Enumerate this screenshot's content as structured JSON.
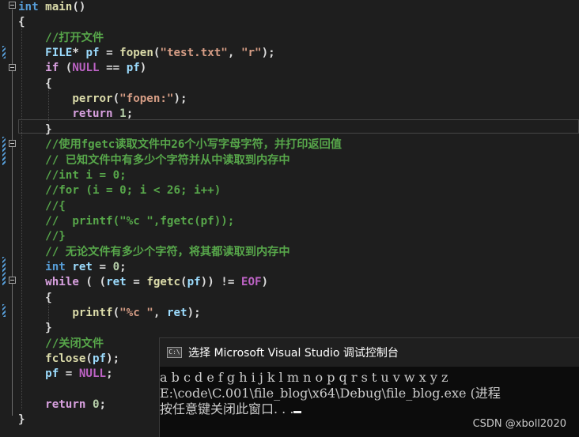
{
  "editor": {
    "lines": [
      {
        "n": "signature",
        "parts": [
          [
            "kw",
            "int"
          ],
          [
            "plain",
            " "
          ],
          [
            "fn",
            "main"
          ],
          [
            "plain",
            "()"
          ]
        ]
      },
      {
        "n": "open-brace",
        "parts": [
          [
            "plain",
            "{"
          ]
        ]
      },
      {
        "n": "comment-open-file",
        "parts": [
          [
            "plain",
            "    "
          ],
          [
            "cmt",
            "//打开文件"
          ]
        ]
      },
      {
        "n": "fopen-line",
        "parts": [
          [
            "plain",
            "    "
          ],
          [
            "var",
            "FILE"
          ],
          [
            "plain",
            "* "
          ],
          [
            "var",
            "pf"
          ],
          [
            "plain",
            " = "
          ],
          [
            "fn",
            "fopen"
          ],
          [
            "plain",
            "("
          ],
          [
            "str",
            "\"test.txt\""
          ],
          [
            "plain",
            ", "
          ],
          [
            "str",
            "\"r\""
          ],
          [
            "plain",
            ");"
          ]
        ]
      },
      {
        "n": "if-line",
        "parts": [
          [
            "plain",
            "    "
          ],
          [
            "ctrl",
            "if"
          ],
          [
            "plain",
            " ("
          ],
          [
            "mac",
            "NULL"
          ],
          [
            "plain",
            " == "
          ],
          [
            "var",
            "pf"
          ],
          [
            "plain",
            ")"
          ]
        ]
      },
      {
        "n": "if-open-brace",
        "parts": [
          [
            "plain",
            "    {"
          ]
        ]
      },
      {
        "n": "perror-line",
        "parts": [
          [
            "plain",
            "        "
          ],
          [
            "fn",
            "perror"
          ],
          [
            "plain",
            "("
          ],
          [
            "str",
            "\"fopen:\""
          ],
          [
            "plain",
            ");"
          ]
        ]
      },
      {
        "n": "return-1-line",
        "parts": [
          [
            "plain",
            "        "
          ],
          [
            "ctrl",
            "return"
          ],
          [
            "plain",
            " "
          ],
          [
            "num",
            "1"
          ],
          [
            "plain",
            ";"
          ]
        ]
      },
      {
        "n": "if-close-brace",
        "parts": [
          [
            "plain",
            "    }"
          ]
        ]
      },
      {
        "n": "comment-fgetc",
        "parts": [
          [
            "plain",
            "    "
          ],
          [
            "cmt",
            "//使用fgetc读取文件中26个小写字母字符，并打印返回值"
          ]
        ]
      },
      {
        "n": "comment-unknown",
        "parts": [
          [
            "plain",
            "    "
          ],
          [
            "cmt",
            "// 已知文件中有多少个字符并从中读取到内存中"
          ]
        ]
      },
      {
        "n": "comment-int-i",
        "parts": [
          [
            "plain",
            "    "
          ],
          [
            "cmt",
            "//int i = 0;"
          ]
        ]
      },
      {
        "n": "comment-for",
        "parts": [
          [
            "plain",
            "    "
          ],
          [
            "cmt",
            "//for (i = 0; i < 26; i++)"
          ]
        ]
      },
      {
        "n": "comment-brace-open",
        "parts": [
          [
            "plain",
            "    "
          ],
          [
            "cmt",
            "//{"
          ]
        ]
      },
      {
        "n": "comment-printf",
        "parts": [
          [
            "plain",
            "    "
          ],
          [
            "cmt",
            "//  printf(\"%c \",fgetc(pf));"
          ]
        ]
      },
      {
        "n": "comment-brace-close",
        "parts": [
          [
            "plain",
            "    "
          ],
          [
            "cmt",
            "//}"
          ]
        ]
      },
      {
        "n": "comment-unknown-count",
        "parts": [
          [
            "plain",
            "    "
          ],
          [
            "cmt",
            "// 无论文件有多少个字符，将其都读取到内存中"
          ]
        ]
      },
      {
        "n": "int-ret-line",
        "parts": [
          [
            "plain",
            "    "
          ],
          [
            "kw",
            "int"
          ],
          [
            "plain",
            " "
          ],
          [
            "var",
            "ret"
          ],
          [
            "plain",
            " = "
          ],
          [
            "num",
            "0"
          ],
          [
            "plain",
            ";"
          ]
        ]
      },
      {
        "n": "while-line",
        "parts": [
          [
            "plain",
            "    "
          ],
          [
            "ctrl",
            "while"
          ],
          [
            "plain",
            " ( ("
          ],
          [
            "var",
            "ret"
          ],
          [
            "plain",
            " = "
          ],
          [
            "fn",
            "fgetc"
          ],
          [
            "plain",
            "("
          ],
          [
            "var",
            "pf"
          ],
          [
            "plain",
            ")) != "
          ],
          [
            "mac",
            "EOF"
          ],
          [
            "plain",
            ")"
          ]
        ]
      },
      {
        "n": "while-open-brace",
        "parts": [
          [
            "plain",
            "    {"
          ]
        ]
      },
      {
        "n": "printf-line",
        "parts": [
          [
            "plain",
            "        "
          ],
          [
            "fn",
            "printf"
          ],
          [
            "plain",
            "("
          ],
          [
            "str",
            "\"%c \""
          ],
          [
            "plain",
            ", "
          ],
          [
            "var",
            "ret"
          ],
          [
            "plain",
            ");"
          ]
        ]
      },
      {
        "n": "while-close-brace",
        "parts": [
          [
            "plain",
            "    }"
          ]
        ]
      },
      {
        "n": "comment-close-file",
        "parts": [
          [
            "plain",
            "    "
          ],
          [
            "cmt",
            "//关闭文件"
          ]
        ]
      },
      {
        "n": "fclose-line",
        "parts": [
          [
            "plain",
            "    "
          ],
          [
            "fn",
            "fclose"
          ],
          [
            "plain",
            "("
          ],
          [
            "var",
            "pf"
          ],
          [
            "plain",
            ");"
          ]
        ]
      },
      {
        "n": "pf-null-line",
        "parts": [
          [
            "plain",
            "    "
          ],
          [
            "var",
            "pf"
          ],
          [
            "plain",
            " = "
          ],
          [
            "mac",
            "NULL"
          ],
          [
            "plain",
            ";"
          ]
        ]
      },
      {
        "n": "blank-line",
        "parts": [
          [
            "plain",
            ""
          ]
        ]
      },
      {
        "n": "return-0-line",
        "parts": [
          [
            "plain",
            "    "
          ],
          [
            "ctrl",
            "return"
          ],
          [
            "plain",
            " "
          ],
          [
            "num",
            "0"
          ],
          [
            "plain",
            ";"
          ]
        ]
      },
      {
        "n": "close-brace",
        "parts": [
          [
            "plain",
            "}"
          ]
        ]
      }
    ]
  },
  "console": {
    "title": "选择 Microsoft Visual Studio 调试控制台",
    "icon_text": "C:\\",
    "output_line1": "a b c d e f g h i j k l m n o p q r s t u v w x y z",
    "output_line2": "E:\\code\\C.001\\file_blog\\x64\\Debug\\file_blog.exe (进程",
    "output_line3": "按任意键关闭此窗口. . ."
  },
  "watermark": "CSDN @xboll2020",
  "colors": {
    "background": "#1e1e1e",
    "keyword": "#569cd6",
    "control": "#d8a0df",
    "function": "#dcdcaa",
    "string": "#d69d85",
    "comment": "#57a64a",
    "macro": "#bd63c5"
  }
}
